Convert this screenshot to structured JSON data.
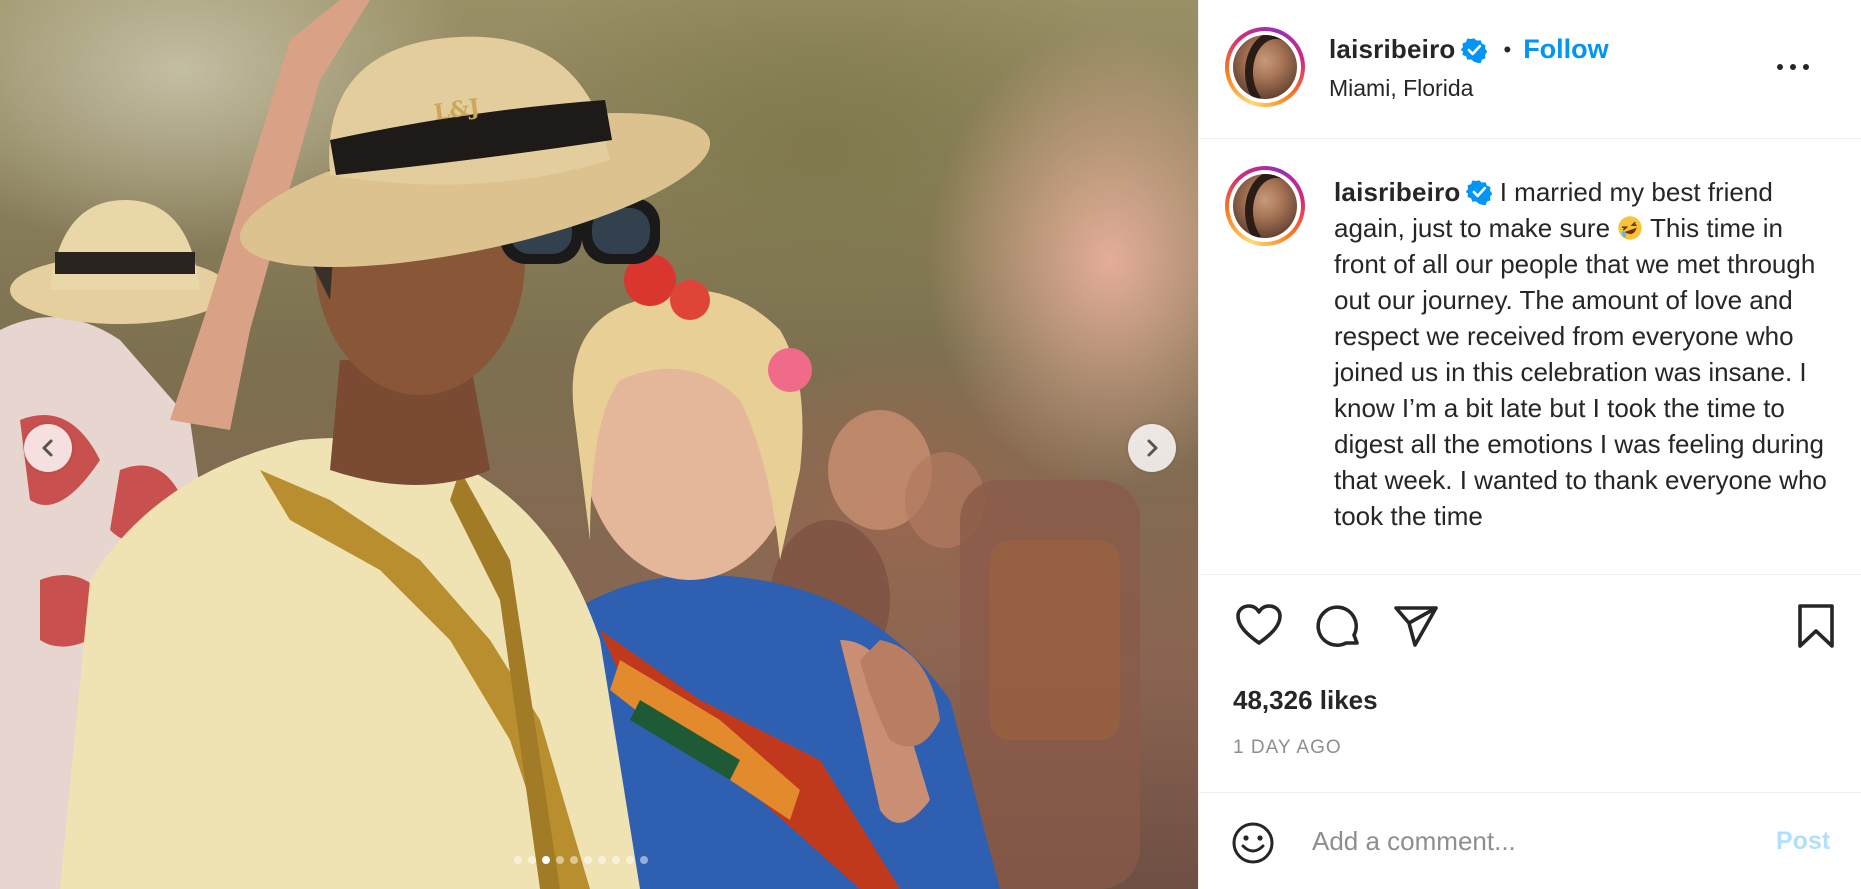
{
  "post": {
    "username": "laisribeiro",
    "follow_label": "Follow",
    "separator": "•",
    "location": "Miami, Florida",
    "caption": "I married my best friend again, just to make sure",
    "caption_cont": "This time in front of all our people that we met through out our journey. The amount of love and respect we received from everyone who joined us in this celebration was insane. I know I’m a bit late but I took the time to digest all the emotions I was feeling during that week. I wanted to thank everyone who took the time",
    "likes": "48,326 likes",
    "time_ago": "1 DAY AGO"
  },
  "media": {
    "hat_band_text": "L&J",
    "carousel_total": 10,
    "carousel_active": 3
  },
  "comment": {
    "placeholder": "Add a comment...",
    "post_label": "Post"
  },
  "colors": {
    "accent": "#0095f6",
    "post_disabled": "#b2dffc",
    "muted": "#8e8e8e",
    "text": "#262626"
  },
  "icons": [
    "verified-badge-icon",
    "more-options-icon",
    "heart-icon",
    "comment-icon",
    "share-icon",
    "bookmark-icon",
    "emoji-icon",
    "chevron-left-icon",
    "chevron-right-icon",
    "laughing-emoji-icon"
  ]
}
